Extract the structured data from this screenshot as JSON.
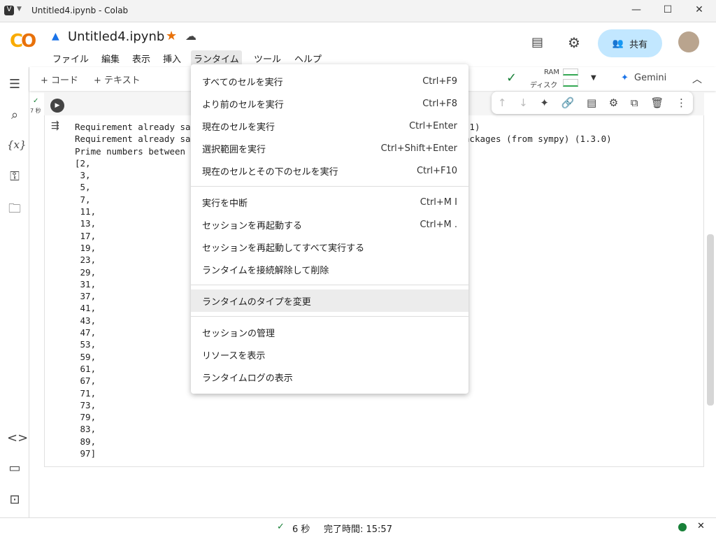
{
  "window": {
    "title": "Untitled4.ipynb - Colab",
    "min": "—",
    "max": "☐",
    "close": "✕"
  },
  "header": {
    "logo": "CO",
    "filename": "Untitled4.ipynb",
    "share": "共有",
    "menus": [
      "ファイル",
      "編集",
      "表示",
      "挿入",
      "ランタイム",
      "ツール",
      "ヘルプ"
    ]
  },
  "toolbar": {
    "add_code": "+ コード",
    "add_text": "+ テキスト",
    "ram": "RAM",
    "disk": "ディスク",
    "gemini": "Gemini"
  },
  "cell": {
    "exec_time": "7 秒",
    "output": [
      "Requirement already sati                                             (1.13.1)",
      "Requirement already sati                                             ist-packages (from sympy) (1.3.0)",
      "Prime numbers between 1",
      "[2,",
      " 3,",
      " 5,",
      " 7,",
      " 11,",
      " 13,",
      " 17,",
      " 19,",
      " 23,",
      " 29,",
      " 31,",
      " 37,",
      " 41,",
      " 43,",
      " 47,",
      " 53,",
      " 59,",
      " 61,",
      " 67,",
      " 71,",
      " 73,",
      " 79,",
      " 83,",
      " 89,",
      " 97]"
    ]
  },
  "dropdown": {
    "groups": [
      [
        {
          "label": "すべてのセルを実行",
          "key": "Ctrl+F9"
        },
        {
          "label": "より前のセルを実行",
          "key": "Ctrl+F8"
        },
        {
          "label": "現在のセルを実行",
          "key": "Ctrl+Enter"
        },
        {
          "label": "選択範囲を実行",
          "key": "Ctrl+Shift+Enter"
        },
        {
          "label": "現在のセルとその下のセルを実行",
          "key": "Ctrl+F10"
        }
      ],
      [
        {
          "label": "実行を中断",
          "key": "Ctrl+M I"
        },
        {
          "label": "セッションを再起動する",
          "key": "Ctrl+M ."
        },
        {
          "label": "セッションを再起動してすべて実行する",
          "key": ""
        },
        {
          "label": "ランタイムを接続解除して削除",
          "key": ""
        }
      ],
      [
        {
          "label": "ランタイムのタイプを変更",
          "key": ""
        }
      ],
      [
        {
          "label": "セッションの管理",
          "key": ""
        },
        {
          "label": "リソースを表示",
          "key": ""
        },
        {
          "label": "ランタイムログの表示",
          "key": ""
        }
      ]
    ]
  },
  "status": {
    "duration": "6 秒",
    "completed": "完了時間: 15:57"
  }
}
